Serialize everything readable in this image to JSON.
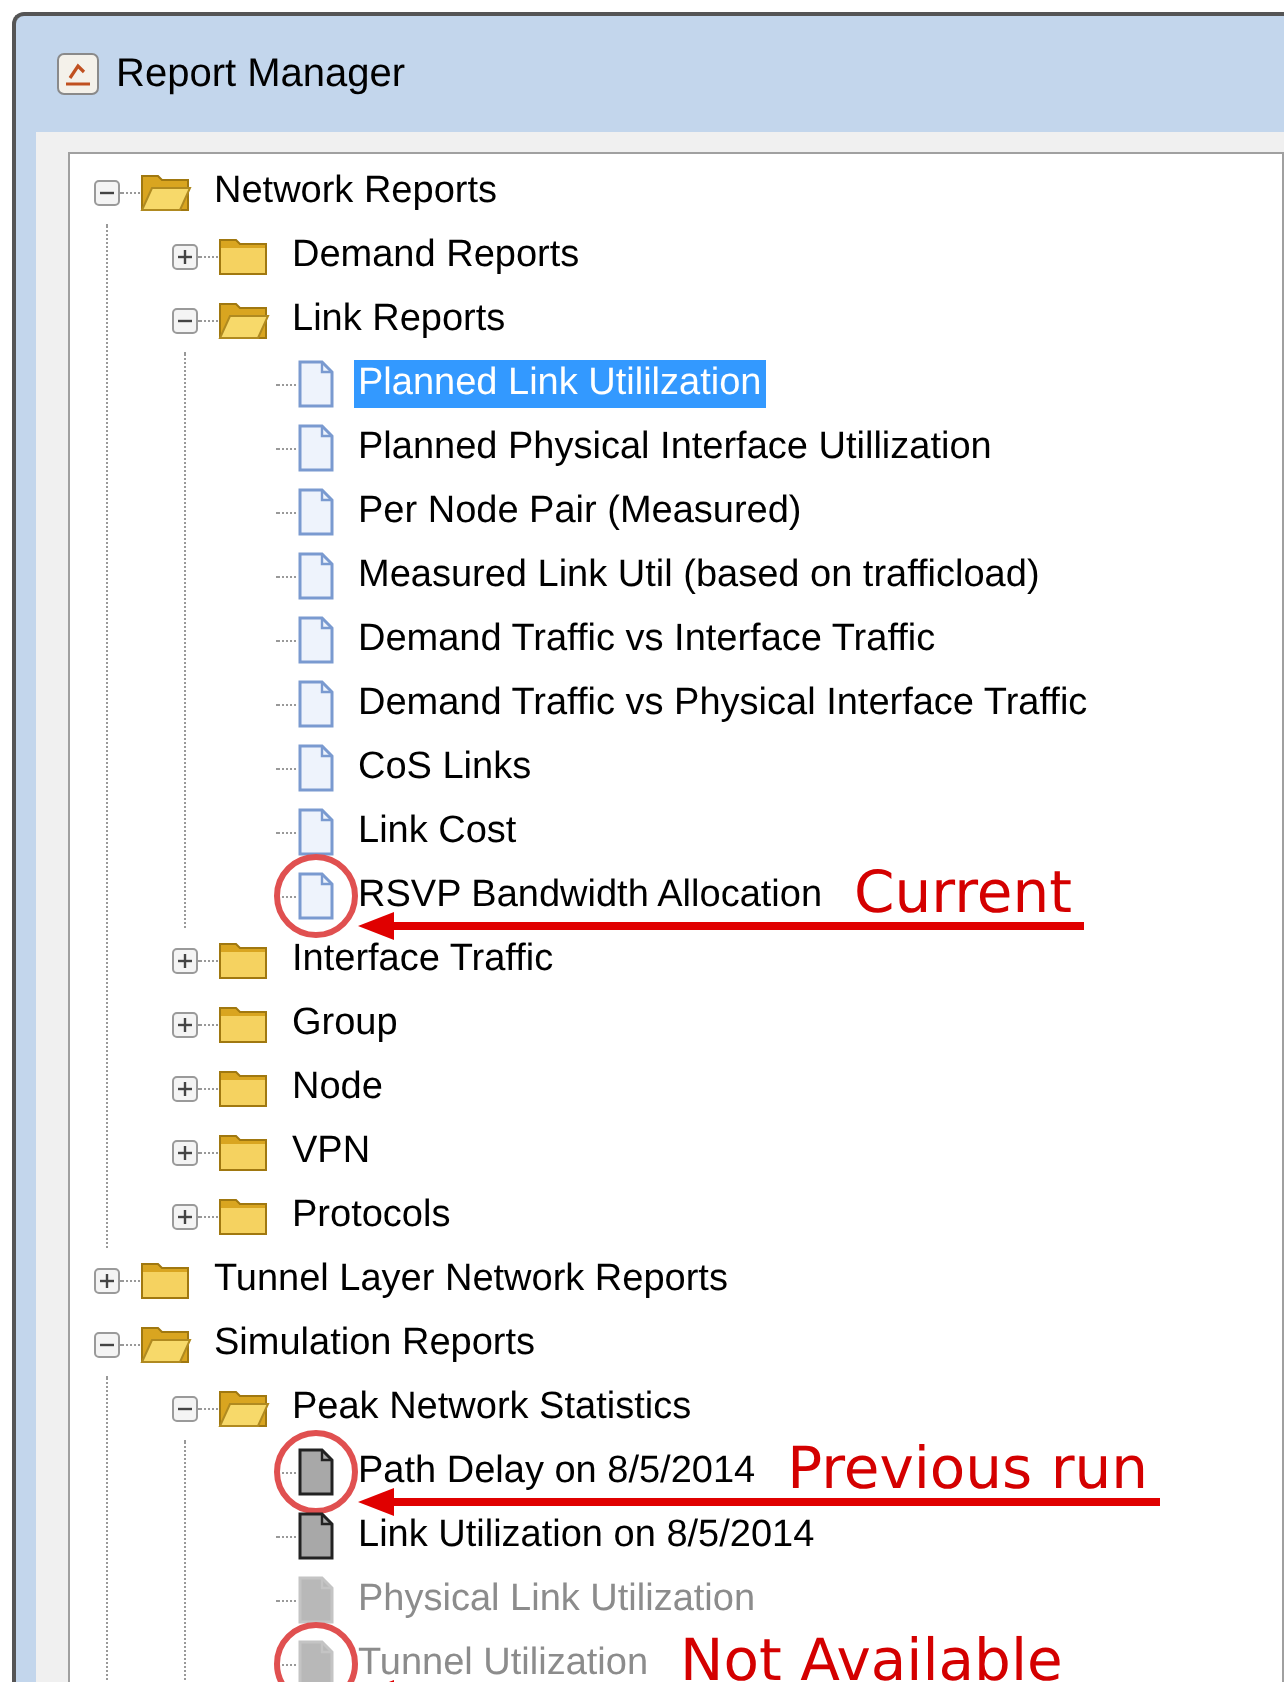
{
  "window": {
    "title": "Report Manager"
  },
  "tree": [
    {
      "kind": "folder",
      "label": "Network Reports",
      "expanded": true,
      "children": [
        {
          "kind": "folder",
          "label": "Demand Reports",
          "expanded": false
        },
        {
          "kind": "folder",
          "label": "Link Reports",
          "expanded": true,
          "children": [
            {
              "kind": "report",
              "label": "Planned Link Utililzation",
              "selected": true
            },
            {
              "kind": "report",
              "label": "Planned Physical Interface Utillization",
              "selected": false
            },
            {
              "kind": "report",
              "label": "Per Node Pair (Measured)",
              "selected": false
            },
            {
              "kind": "report",
              "label": "Measured Link Util (based on trafficload)",
              "selected": false
            },
            {
              "kind": "report",
              "label": "Demand Traffic vs Interface Traffic",
              "selected": false
            },
            {
              "kind": "report",
              "label": "Demand Traffic vs Physical Interface Traffic",
              "selected": false
            },
            {
              "kind": "report",
              "label": "CoS Links",
              "selected": false
            },
            {
              "kind": "report",
              "label": "Link Cost",
              "selected": false
            },
            {
              "kind": "report",
              "label": "RSVP Bandwidth Allocation",
              "selected": false,
              "annotation": {
                "label": "Current"
              }
            }
          ]
        },
        {
          "kind": "folder",
          "label": "Interface Traffic",
          "expanded": false
        },
        {
          "kind": "folder",
          "label": "Group",
          "expanded": false
        },
        {
          "kind": "folder",
          "label": "Node",
          "expanded": false
        },
        {
          "kind": "folder",
          "label": "VPN",
          "expanded": false
        },
        {
          "kind": "folder",
          "label": "Protocols",
          "expanded": false
        }
      ]
    },
    {
      "kind": "folder",
      "label": "Tunnel Layer Network Reports",
      "expanded": false
    },
    {
      "kind": "folder",
      "label": "Simulation Reports",
      "expanded": true,
      "children": [
        {
          "kind": "folder",
          "label": "Peak Network Statistics",
          "expanded": true,
          "children": [
            {
              "kind": "result",
              "label": "Path Delay on 8/5/2014",
              "disabled": false,
              "annotation": {
                "label": "Previous run"
              }
            },
            {
              "kind": "result",
              "label": "Link Utilization on 8/5/2014",
              "disabled": false
            },
            {
              "kind": "result",
              "label": "Physical Link Utilization",
              "disabled": true
            },
            {
              "kind": "result",
              "label": "Tunnel Utilization",
              "disabled": true,
              "annotation": {
                "label": "Not Available"
              }
            }
          ]
        }
      ]
    }
  ]
}
